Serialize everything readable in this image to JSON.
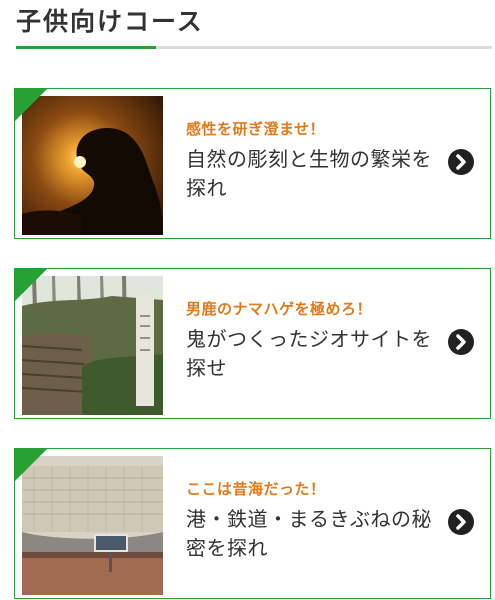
{
  "section": {
    "title": "子供向けコース"
  },
  "courses": [
    {
      "subtitle": "感性を研ぎ澄ませ！",
      "title": "自然の彫刻と生物の繁栄を探れ",
      "image": "sunset-rock-silhouette",
      "icon": "chevron-right-circle-icon"
    },
    {
      "subtitle": "男鹿のナマハゲを極めろ！",
      "title": "鬼がつくったジオサイトを探せ",
      "image": "forest-trail-stone-marker",
      "icon": "chevron-right-circle-icon"
    },
    {
      "subtitle": "ここは昔海だった！",
      "title": "港・鉄道・まるきぶねの秘密を探れ",
      "image": "museum-exhibit-wall",
      "icon": "chevron-right-circle-icon"
    }
  ],
  "colors": {
    "accent": "#27a034",
    "subtitle": "#e27a1c",
    "text": "#333333"
  }
}
